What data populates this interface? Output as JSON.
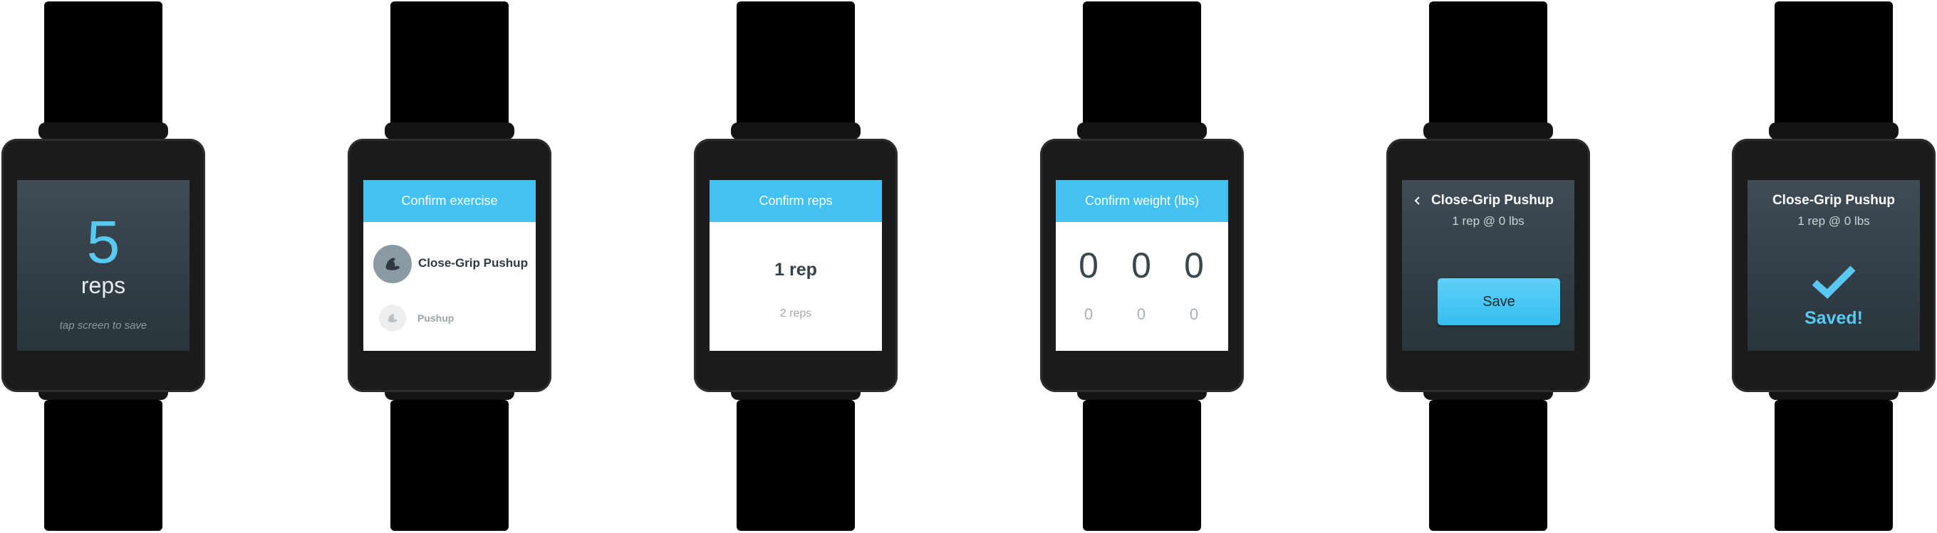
{
  "colors": {
    "accent": "#42c1f2",
    "accent_text": "#59c8f3",
    "screen_dark": "#333f47",
    "strap": "#000000"
  },
  "watches": [
    {
      "screen": "reps-counter",
      "count": "5",
      "unit": "reps",
      "hint": "tap screen to save"
    },
    {
      "screen": "confirm-exercise",
      "header": "Confirm exercise",
      "selected_exercise": "Close-Grip Pushup",
      "selected_icon": "muscle-arm-icon",
      "next_exercise": "Pushup",
      "next_icon": "muscle-arm-icon"
    },
    {
      "screen": "confirm-reps",
      "header": "Confirm reps",
      "selected": "1 rep",
      "next": "2 reps"
    },
    {
      "screen": "confirm-weight",
      "header": "Confirm weight (lbs)",
      "digits": [
        "0",
        "0",
        "0"
      ],
      "next_digits": [
        "0",
        "0",
        "0"
      ]
    },
    {
      "screen": "save-set",
      "back_icon": "chevron-left-icon",
      "title": "Close-Grip Pushup",
      "subtitle": "1 rep @ 0 lbs",
      "button": "Save"
    },
    {
      "screen": "saved-confirmation",
      "title": "Close-Grip Pushup",
      "subtitle": "1 rep @ 0 lbs",
      "icon": "checkmark-icon",
      "status": "Saved!"
    }
  ]
}
